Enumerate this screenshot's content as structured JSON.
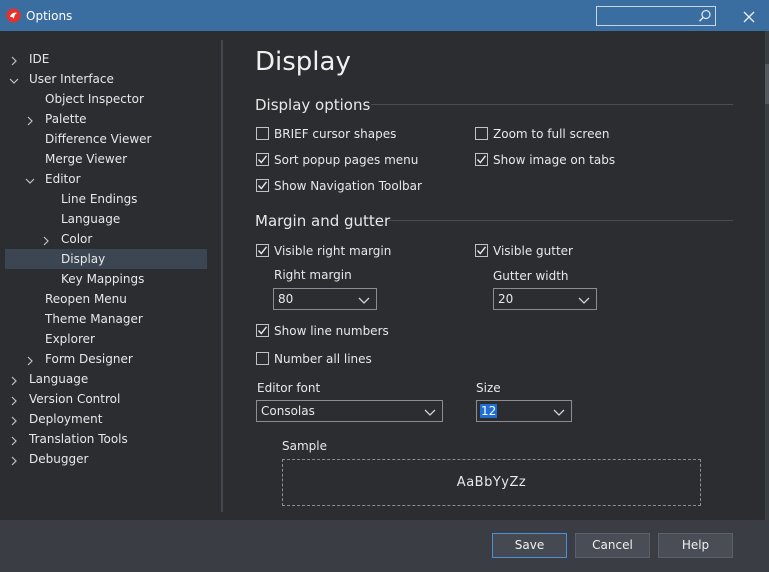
{
  "window": {
    "title": "Options",
    "search": {
      "placeholder": ""
    }
  },
  "tree": [
    {
      "label": "IDE",
      "level": 0,
      "state": "collapsed"
    },
    {
      "label": "User Interface",
      "level": 0,
      "state": "expanded"
    },
    {
      "label": "Object Inspector",
      "level": 1,
      "state": "leaf"
    },
    {
      "label": "Palette",
      "level": 1,
      "state": "collapsed"
    },
    {
      "label": "Difference Viewer",
      "level": 1,
      "state": "leaf"
    },
    {
      "label": "Merge Viewer",
      "level": 1,
      "state": "leaf"
    },
    {
      "label": "Editor",
      "level": 1,
      "state": "expanded"
    },
    {
      "label": "Line Endings",
      "level": 2,
      "state": "leaf"
    },
    {
      "label": "Language",
      "level": 2,
      "state": "leaf"
    },
    {
      "label": "Color",
      "level": 2,
      "state": "collapsed"
    },
    {
      "label": "Display",
      "level": 2,
      "state": "leaf",
      "selected": true
    },
    {
      "label": "Key Mappings",
      "level": 2,
      "state": "leaf"
    },
    {
      "label": "Reopen Menu",
      "level": 1,
      "state": "leaf"
    },
    {
      "label": "Theme Manager",
      "level": 1,
      "state": "leaf"
    },
    {
      "label": "Explorer",
      "level": 1,
      "state": "leaf"
    },
    {
      "label": "Form Designer",
      "level": 1,
      "state": "collapsed"
    },
    {
      "label": "Language",
      "level": 0,
      "state": "collapsed"
    },
    {
      "label": "Version Control",
      "level": 0,
      "state": "collapsed"
    },
    {
      "label": "Deployment",
      "level": 0,
      "state": "collapsed"
    },
    {
      "label": "Translation Tools",
      "level": 0,
      "state": "collapsed"
    },
    {
      "label": "Debugger",
      "level": 0,
      "state": "collapsed"
    }
  ],
  "page": {
    "title": "Display",
    "display_options": {
      "heading": "Display options",
      "brief_cursor": {
        "label": "BRIEF cursor shapes",
        "checked": false
      },
      "zoom_full": {
        "label": "Zoom to full screen",
        "checked": false
      },
      "sort_popup": {
        "label": "Sort popup pages menu",
        "checked": true
      },
      "show_image_tabs": {
        "label": "Show image on tabs",
        "checked": true
      },
      "show_nav_toolbar": {
        "label": "Show Navigation Toolbar",
        "checked": true
      }
    },
    "margin_gutter": {
      "heading": "Margin and gutter",
      "visible_right_margin": {
        "label": "Visible right margin",
        "checked": true
      },
      "visible_gutter": {
        "label": "Visible gutter",
        "checked": true
      },
      "right_margin_label": "Right margin",
      "right_margin_value": "80",
      "gutter_width_label": "Gutter width",
      "gutter_width_value": "20",
      "show_line_numbers": {
        "label": "Show line numbers",
        "checked": true
      },
      "number_all_lines": {
        "label": "Number all lines",
        "checked": false
      }
    },
    "font": {
      "editor_font_label": "Editor font",
      "editor_font_value": "Consolas",
      "size_label": "Size",
      "size_value": "12"
    },
    "sample": {
      "label": "Sample",
      "text": "AaBbYyZz"
    }
  },
  "buttons": {
    "save": "Save",
    "cancel": "Cancel",
    "help": "Help"
  },
  "colors": {
    "titlebar": "#3b6ea0",
    "background": "#2b2d31",
    "footer": "#3a3d43",
    "selection": "#3b4652",
    "accent": "#1e6fd0"
  }
}
